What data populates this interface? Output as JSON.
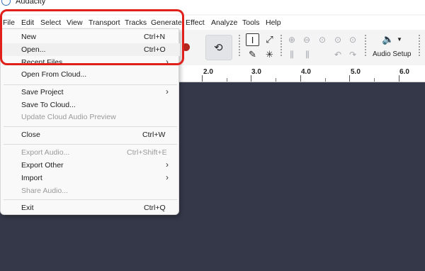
{
  "app": {
    "title": "Audacity"
  },
  "menubar": {
    "items": [
      "File",
      "Edit",
      "Select",
      "View",
      "Transport",
      "Tracks",
      "Generate",
      "Effect",
      "Analyze",
      "Tools",
      "Help"
    ]
  },
  "toolbar": {
    "audio_setup_label": "Audio Setup",
    "icons": [
      "record-icon",
      "loop-icon",
      "selection-tool-icon",
      "envelope-tool-icon",
      "draw-tool-icon",
      "multi-tool-icon",
      "zoom-in-icon",
      "zoom-out-icon",
      "fit-selection-icon",
      "fit-project-icon",
      "zoom-toggle-icon",
      "trim-icon",
      "silence-icon",
      "undo-icon",
      "redo-icon",
      "speaker-icon"
    ]
  },
  "ruler": {
    "ticks": [
      "2.0",
      "3.0",
      "4.0",
      "5.0",
      "6.0"
    ]
  },
  "file_menu": {
    "new": {
      "label": "New",
      "shortcut": "Ctrl+N"
    },
    "open": {
      "label": "Open...",
      "shortcut": "Ctrl+O"
    },
    "recent": {
      "label": "Recent Files"
    },
    "open_cloud": {
      "label": "Open From Cloud..."
    },
    "save_project": {
      "label": "Save Project"
    },
    "save_cloud": {
      "label": "Save To Cloud..."
    },
    "update_cloud": {
      "label": "Update Cloud Audio Preview"
    },
    "close": {
      "label": "Close",
      "shortcut": "Ctrl+W"
    },
    "export_audio": {
      "label": "Export Audio...",
      "shortcut": "Ctrl+Shift+E"
    },
    "export_other": {
      "label": "Export Other"
    },
    "import": {
      "label": "Import"
    },
    "share_audio": {
      "label": "Share Audio..."
    },
    "exit": {
      "label": "Exit",
      "shortcut": "Ctrl+Q"
    }
  },
  "colors": {
    "highlight": "#e0201b",
    "record": "#b3261e",
    "track_bg": "#353849"
  }
}
